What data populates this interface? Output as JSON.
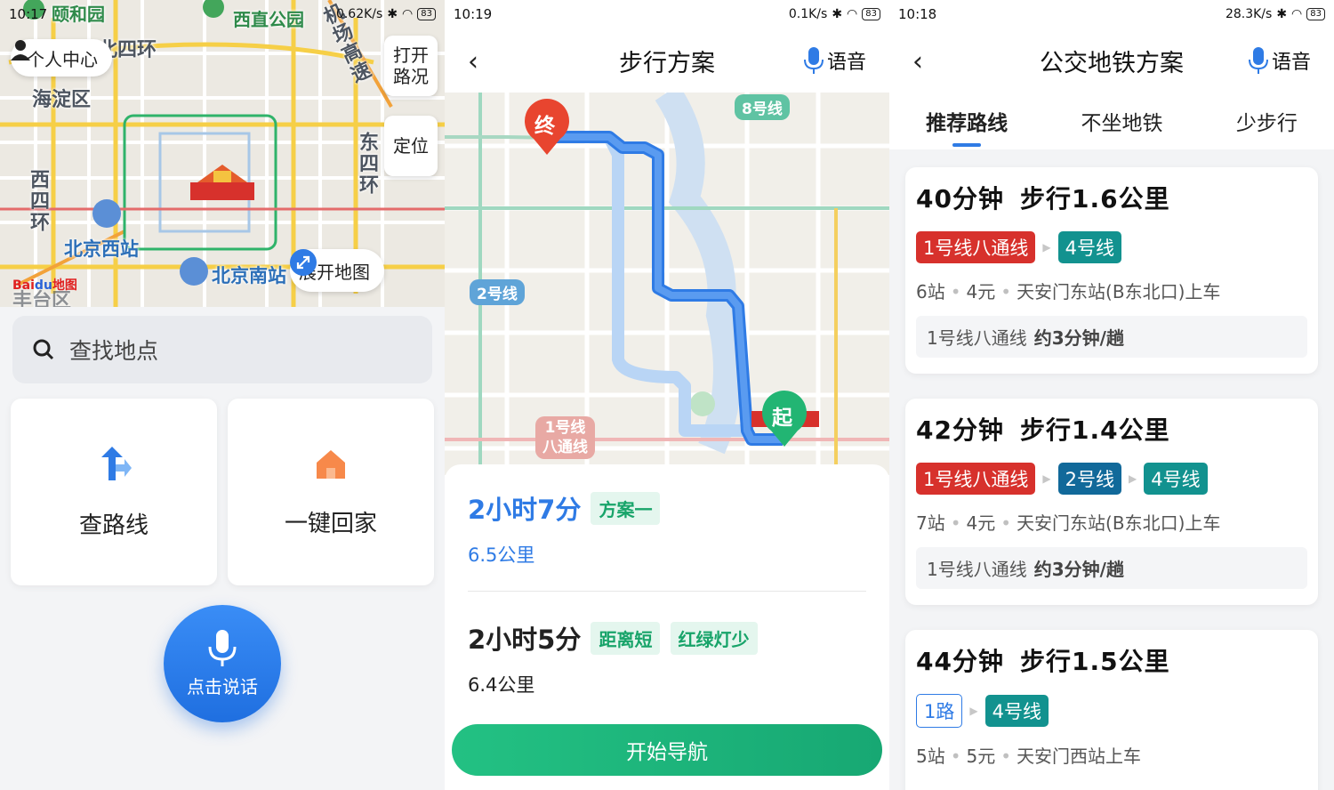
{
  "screen1": {
    "status": {
      "time": "10:17",
      "speed": "0.62K/s",
      "battery": "83"
    },
    "map_labels": {
      "summer_palace": "颐和园",
      "xizhimen_park": "西直公园",
      "north_ring": "北四环",
      "haidian": "海淀区",
      "airport_highway": "机场高速",
      "east_fourth_ring": "东四环",
      "west_fourth_ring": "西四环",
      "beijing_west": "北京西站",
      "beijing_south": "北京南站",
      "fengtai": "丰台区"
    },
    "personal_center": "个人中心",
    "traffic_button": "打开路况",
    "locate_button": "定位",
    "expand_map": "展开地图",
    "brand": {
      "part1": "Bai",
      "part2": "du",
      "part3": "地图"
    },
    "search_placeholder": "查找地点",
    "tiles": {
      "route": "查路线",
      "home": "一键回家"
    },
    "voice_button": "点击说话"
  },
  "screen2": {
    "status": {
      "time": "10:19",
      "speed": "0.1K/s",
      "battery": "83"
    },
    "header": {
      "back": "‹",
      "title": "步行方案",
      "voice": "语音"
    },
    "map_tags": {
      "line8": "8号线",
      "line2": "2号线",
      "line1_a": "1号线",
      "line1_b": "八通线",
      "end": "终",
      "start": "起"
    },
    "plans": [
      {
        "time": "2小时7分",
        "tags": [
          "方案一"
        ],
        "distance": "6.5公里"
      },
      {
        "time": "2小时5分",
        "tags": [
          "距离短",
          "红绿灯少"
        ],
        "distance": "6.4公里"
      }
    ],
    "nav_button": "开始导航"
  },
  "screen3": {
    "status": {
      "time": "10:18",
      "speed": "28.3K/s",
      "battery": "83"
    },
    "header": {
      "back": "‹",
      "title": "公交地铁方案",
      "voice": "语音"
    },
    "tabs": [
      "推荐路线",
      "不坐地铁",
      "少步行"
    ],
    "cards": [
      {
        "duration": "40分钟",
        "walk": "步行1.6公里",
        "routes": [
          {
            "name": "1号线八通线",
            "color": "red"
          },
          {
            "name": "4号线",
            "color": "teal"
          }
        ],
        "stops": "6站",
        "fare": "4元",
        "board": "天安门东站(B东北口)上车",
        "freq_line": "1号线八通线",
        "freq": "约3分钟/趟"
      },
      {
        "duration": "42分钟",
        "walk": "步行1.4公里",
        "routes": [
          {
            "name": "1号线八通线",
            "color": "red"
          },
          {
            "name": "2号线",
            "color": "blue"
          },
          {
            "name": "4号线",
            "color": "teal"
          }
        ],
        "stops": "7站",
        "fare": "4元",
        "board": "天安门东站(B东北口)上车",
        "freq_line": "1号线八通线",
        "freq": "约3分钟/趟"
      },
      {
        "duration": "44分钟",
        "walk": "步行1.5公里",
        "routes": [
          {
            "name": "1路",
            "color": "bus"
          },
          {
            "name": "4号线",
            "color": "teal"
          }
        ],
        "stops": "5站",
        "fare": "5元",
        "board": "天安门西站上车"
      }
    ]
  }
}
